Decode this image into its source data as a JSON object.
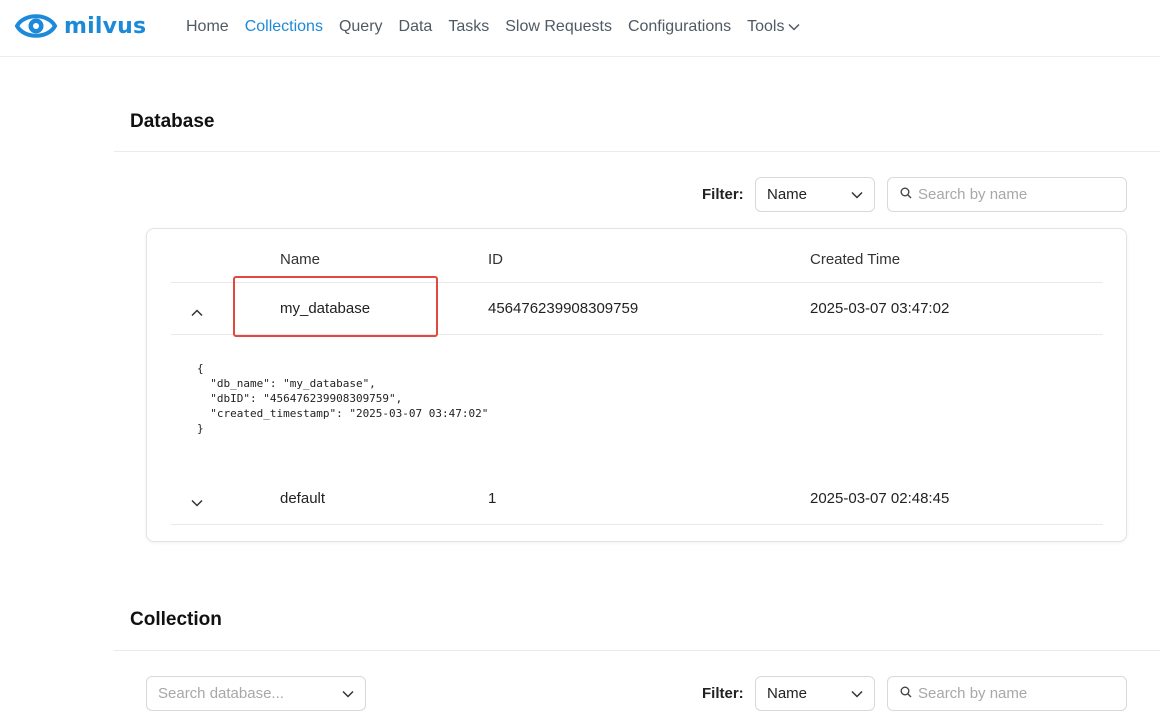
{
  "app": {
    "logo_text": "milvus",
    "brand_color": "#1c8ad9",
    "highlight_color": "#e0493f"
  },
  "nav": {
    "items": [
      {
        "label": "Home",
        "active": false
      },
      {
        "label": "Collections",
        "active": true
      },
      {
        "label": "Query",
        "active": false
      },
      {
        "label": "Data",
        "active": false
      },
      {
        "label": "Tasks",
        "active": false
      },
      {
        "label": "Slow Requests",
        "active": false
      },
      {
        "label": "Configurations",
        "active": false
      }
    ],
    "tools_label": "Tools"
  },
  "database_section": {
    "title": "Database",
    "filter_label": "Filter:",
    "filter_select_value": "Name",
    "search_placeholder": "Search by name",
    "table": {
      "columns": [
        "Name",
        "ID",
        "Created Time"
      ],
      "rows": [
        {
          "name": "my_database",
          "id": "456476239908309759",
          "created": "2025-03-07 03:47:02",
          "expanded": true,
          "detail_json": "{\n  \"db_name\": \"my_database\",\n  \"dbID\": \"456476239908309759\",\n  \"created_timestamp\": \"2025-03-07 03:47:02\"\n}"
        },
        {
          "name": "default",
          "id": "1",
          "created": "2025-03-07 02:48:45",
          "expanded": false
        }
      ]
    }
  },
  "collection_section": {
    "title": "Collection",
    "database_select_placeholder": "Search database...",
    "filter_label": "Filter:",
    "filter_select_value": "Name",
    "search_placeholder": "Search by name"
  }
}
